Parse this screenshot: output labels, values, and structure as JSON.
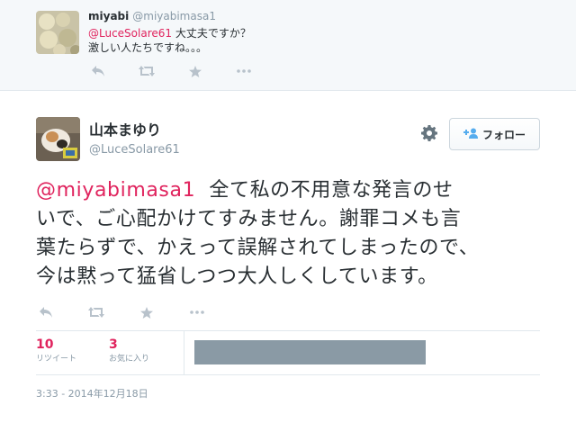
{
  "reply": {
    "name": "miyabi",
    "handle": "@miyabimasa1",
    "mention": "@LuceSolare61",
    "line1_rest": " 大丈夫ですか？",
    "line2": "激しい人たちですね。。。",
    "actions": [
      "reply-icon",
      "retweet-icon",
      "favorite-icon",
      "more-icon"
    ]
  },
  "tweet": {
    "name": "山本まゆり",
    "handle": "@LuceSolare61",
    "follow_label": "フォロー",
    "mention": "@miyabimasa1",
    "line1_rest": "  全て私の不用意な発言のせ",
    "line2": "いで、ご心配かけてすみません。謝罪コメも言",
    "line3": "葉たらずで、かえって誤解されてしまったので、",
    "line4": "今は黙って猛省しつつ大人しくしています。",
    "actions": [
      "reply-icon",
      "retweet-icon",
      "favorite-icon",
      "more-icon"
    ]
  },
  "stats": {
    "retweets_count": "10",
    "retweets_label": "リツイート",
    "favorites_count": "3",
    "favorites_label": "お気に入り"
  },
  "timestamp": "3:33 - 2014年12月18日",
  "colors": {
    "mention": "#e0245e",
    "muted": "#8899a6",
    "icon": "#b8c2cb",
    "follow_icon": "#55acee"
  }
}
